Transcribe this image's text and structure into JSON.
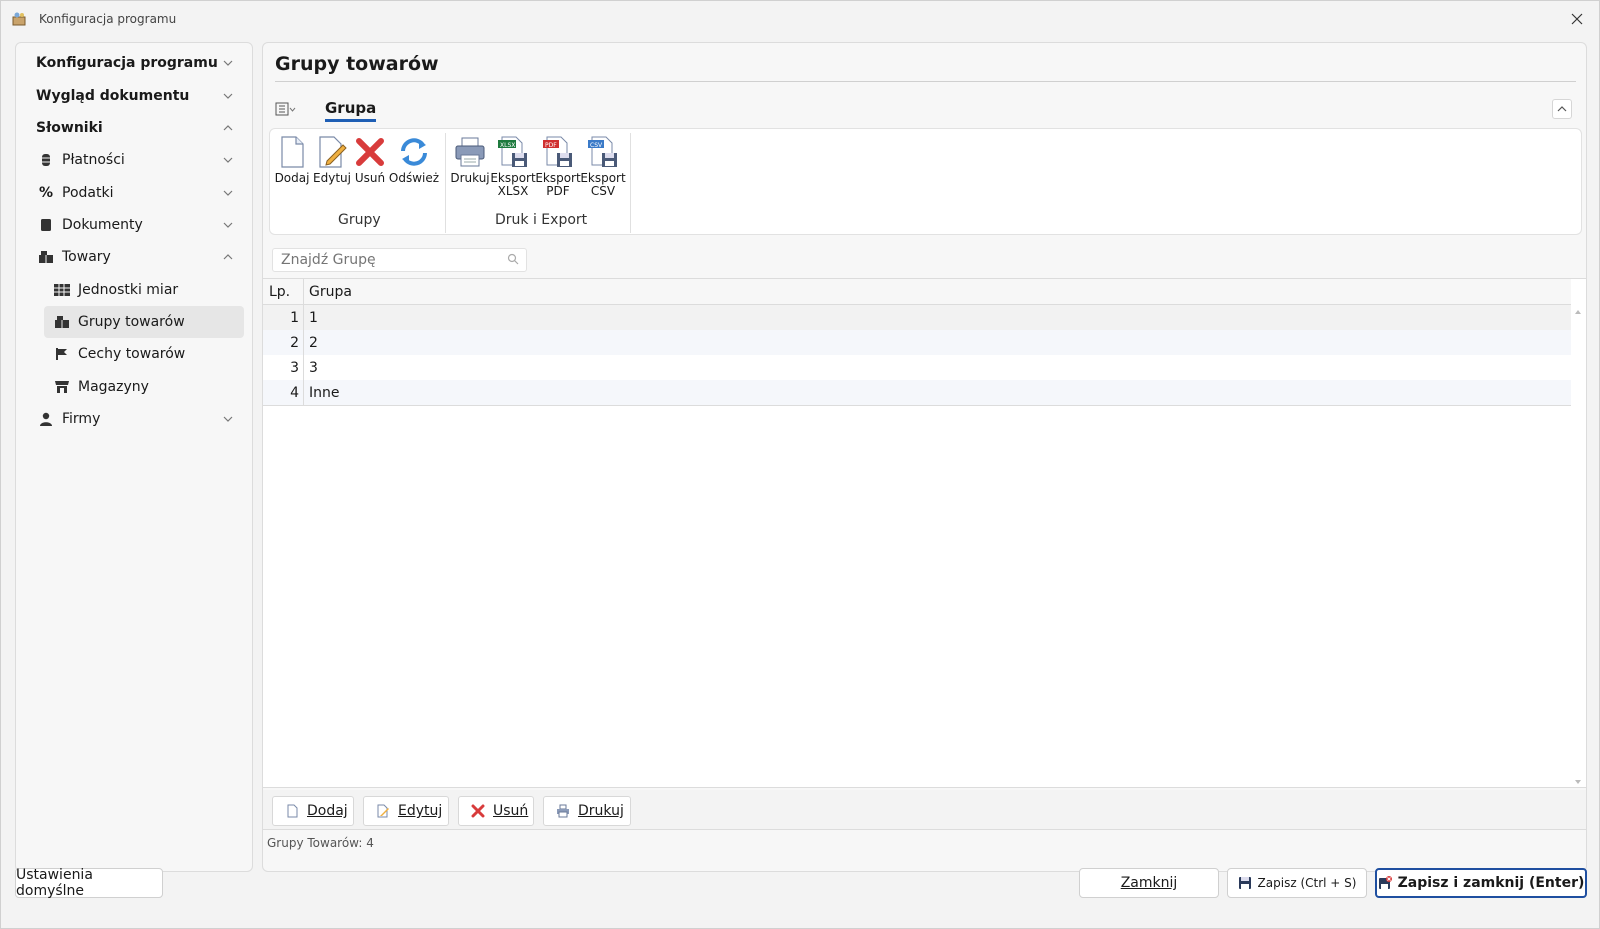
{
  "window": {
    "title": "Konfiguracja programu"
  },
  "sidebar": {
    "items": [
      {
        "label": "Konfiguracja programu"
      },
      {
        "label": "Wygląd dokumentu"
      },
      {
        "label": "Słowniki"
      },
      {
        "label": "Płatności"
      },
      {
        "label": "Podatki"
      },
      {
        "label": "Dokumenty"
      },
      {
        "label": "Towary"
      },
      {
        "label": "Jednostki miar"
      },
      {
        "label": "Grupy towarów"
      },
      {
        "label": "Cechy towarów"
      },
      {
        "label": "Magazyny"
      },
      {
        "label": "Firmy"
      }
    ]
  },
  "main": {
    "title": "Grupy towarów",
    "ribbon_tab": "Grupa",
    "ribbon": {
      "add": "Dodaj",
      "edit": "Edytuj",
      "delete": "Usuń",
      "refresh": "Odśwież",
      "group1": "Grupy",
      "print": "Drukuj",
      "xlsx_1": "Eksport",
      "xlsx_2": "XLSX",
      "pdf_1": "Eksport",
      "pdf_2": "PDF",
      "csv_1": "Eksport",
      "csv_2": "CSV",
      "group2": "Druk i Export"
    },
    "search_placeholder": "Znajdź Grupę",
    "grid": {
      "headers": {
        "lp": "Lp.",
        "grupa": "Grupa"
      },
      "rows": [
        {
          "lp": "1",
          "grupa": "1"
        },
        {
          "lp": "2",
          "grupa": "2"
        },
        {
          "lp": "3",
          "grupa": "3"
        },
        {
          "lp": "4",
          "grupa": "Inne"
        }
      ]
    },
    "buttons": {
      "add": "Dodaj",
      "edit": "Edytuj",
      "delete": "Usuń",
      "print": "Drukuj"
    },
    "status": "Grupy Towarów: 4"
  },
  "footer": {
    "defaults": "Ustawienia domyślne",
    "close": "Zamknij",
    "save": "Zapisz (Ctrl + S)",
    "save_close": "Zapisz i zamknij (Enter)"
  },
  "colors": {
    "accent": "#1f5fb5",
    "selected": "#e6e6e6"
  }
}
